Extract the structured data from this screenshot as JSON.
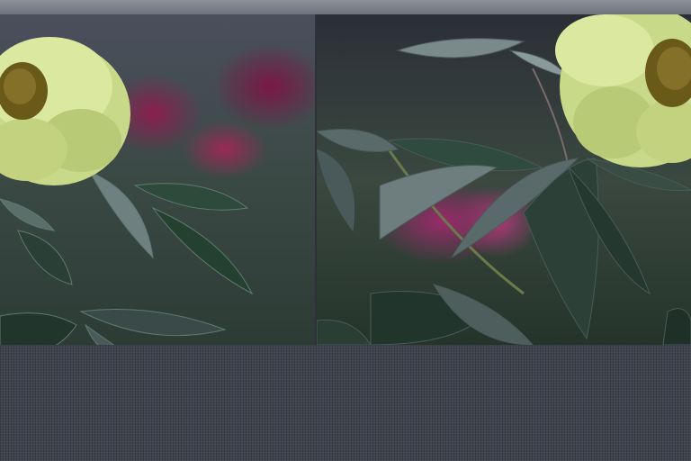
{
  "image": {
    "description_items": [],
    "colors": {
      "flower_yellow": "#d8e69a",
      "flower_center": "#6a5a1a",
      "leaf_dark": "#2f4a3f",
      "leaf_highlight": "#8a9a9a",
      "blossom_magenta": "#9a2a6a",
      "background_gray": "#3f434e"
    }
  }
}
